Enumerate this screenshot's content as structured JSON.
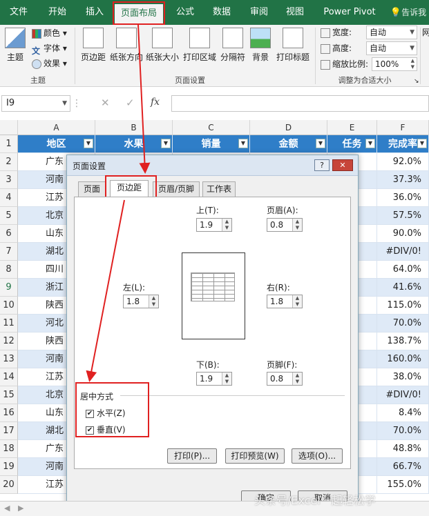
{
  "ribbon": {
    "tabs": [
      "文件",
      "开始",
      "插入",
      "页面布局",
      "公式",
      "数据",
      "审阅",
      "视图",
      "Power Pivot"
    ],
    "active_tab": "页面布局",
    "tell_me": "告诉我你",
    "theme_group": {
      "label": "主题",
      "theme_btn": "主题",
      "colors": "颜色",
      "fonts": "字体",
      "effects": "效果"
    },
    "page_setup_group": {
      "label": "页面设置",
      "buttons": [
        "页边距",
        "纸张方向",
        "纸张大小",
        "打印区域",
        "分隔符",
        "背景",
        "打印标题"
      ]
    },
    "scale_group": {
      "label": "调整为合适大小",
      "width_label": "宽度:",
      "width_value": "自动",
      "height_label": "高度:",
      "height_value": "自动",
      "scale_label": "缩放比例:",
      "scale_value": "100%",
      "extra": "网"
    }
  },
  "formula_bar": {
    "name_box": "I9",
    "cancel": "✕",
    "enter": "✓",
    "fx": "fx",
    "formula": ""
  },
  "sheet": {
    "columns": [
      "A",
      "B",
      "C",
      "D",
      "E",
      "F"
    ],
    "headers": [
      "地区",
      "水果",
      "销量",
      "金额",
      "任务",
      "完成率"
    ],
    "rows": [
      {
        "n": "1"
      },
      {
        "n": "2",
        "a": "广东",
        "f": "92.0%"
      },
      {
        "n": "3",
        "a": "河南",
        "f": "37.3%"
      },
      {
        "n": "4",
        "a": "江苏",
        "f": "36.0%"
      },
      {
        "n": "5",
        "a": "北京",
        "f": "57.5%"
      },
      {
        "n": "6",
        "a": "山东",
        "f": "90.0%"
      },
      {
        "n": "7",
        "a": "湖北",
        "f": "#DIV/0!"
      },
      {
        "n": "8",
        "a": "四川",
        "f": "64.0%"
      },
      {
        "n": "9",
        "a": "浙江",
        "f": "41.6%"
      },
      {
        "n": "10",
        "a": "陕西",
        "f": "115.0%"
      },
      {
        "n": "11",
        "a": "河北",
        "f": "70.0%"
      },
      {
        "n": "12",
        "a": "陕西",
        "f": "138.7%"
      },
      {
        "n": "13",
        "a": "河南",
        "f": "160.0%"
      },
      {
        "n": "14",
        "a": "江苏",
        "f": "38.0%"
      },
      {
        "n": "15",
        "a": "北京",
        "f": "#DIV/0!"
      },
      {
        "n": "16",
        "a": "山东",
        "f": "8.4%"
      },
      {
        "n": "17",
        "a": "湖北",
        "f": "70.0%"
      },
      {
        "n": "18",
        "a": "广东",
        "f": "48.8%"
      },
      {
        "n": "19",
        "a": "河南",
        "f": "66.7%"
      },
      {
        "n": "20",
        "a": "江苏",
        "f": "155.0%"
      }
    ]
  },
  "dialog": {
    "title": "页面设置",
    "help": "?",
    "close": "✕",
    "tabs": [
      "页面",
      "页边距",
      "页眉/页脚",
      "工作表"
    ],
    "active_tab": "页边距",
    "top_label": "上(T):",
    "top_value": "1.9",
    "header_label": "页眉(A):",
    "header_value": "0.8",
    "left_label": "左(L):",
    "left_value": "1.8",
    "right_label": "右(R):",
    "right_value": "1.8",
    "bottom_label": "下(B):",
    "bottom_value": "1.9",
    "footer_label": "页脚(F):",
    "footer_value": "0.8",
    "center_section": "居中方式",
    "horizontal": "水平(Z)",
    "vertical": "垂直(V)",
    "horizontal_checked": true,
    "vertical_checked": true,
    "print_btn": "打印(P)...",
    "preview_btn": "打印预览(W)",
    "options_btn": "选项(O)...",
    "ok_btn": "确定",
    "cancel_btn": "取消"
  },
  "watermark": "头条号/Excel一起轻松学",
  "colors": {
    "excel_green": "#217346",
    "header_blue": "#2f7ec8",
    "highlight_red": "#e02020",
    "band": "#dfeaf7"
  }
}
